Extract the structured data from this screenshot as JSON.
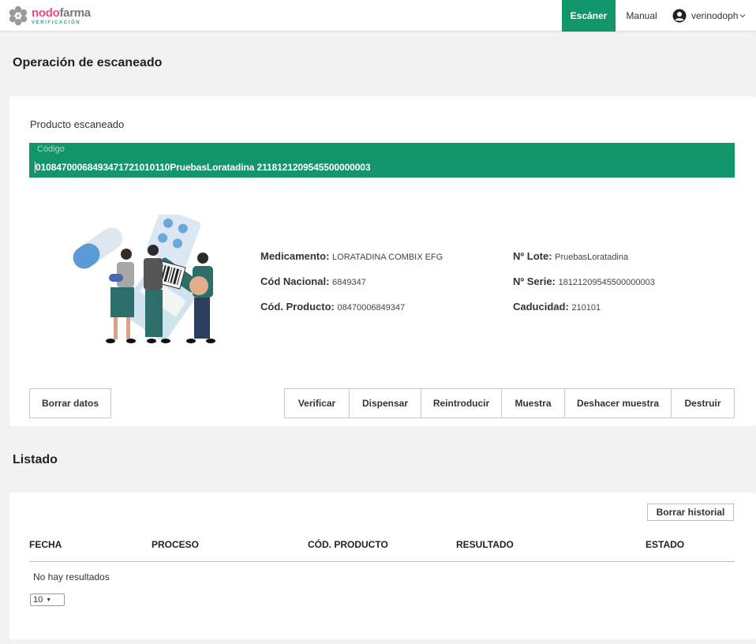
{
  "logo": {
    "name_part1": "nodo",
    "name_part2": "farma",
    "sub": "VERIFICACIÓN"
  },
  "nav": {
    "scanner": "Escáner",
    "manual": "Manual",
    "user": "verinodoph"
  },
  "scan": {
    "title": "Operación de escaneado",
    "subheading": "Producto escaneado",
    "code_label": "Código",
    "code_value": "01084700068493471721010110PruebasLoratadina 2118121209545500000003",
    "fields": {
      "medicamento_label": "Medicamento:",
      "medicamento_value": "LORATADINA COMBIX EFG",
      "nacional_label": "Cód Nacional:",
      "nacional_value": "6849347",
      "producto_label": "Cód. Producto:",
      "producto_value": "08470006849347",
      "lote_label": "Nº Lote:",
      "lote_value": "PruebasLoratadina",
      "serie_label": "Nº Serie:",
      "serie_value": "18121209545500000003",
      "caducidad_label": "Caducidad:",
      "caducidad_value": "210101"
    },
    "buttons": {
      "clear": "Borrar datos",
      "verify": "Verificar",
      "dispense": "Dispensar",
      "reintroduce": "Reintroducir",
      "sample": "Muestra",
      "undo_sample": "Deshacer muestra",
      "destroy": "Destruir"
    }
  },
  "list": {
    "title": "Listado",
    "clear_history": "Borrar historial",
    "columns": [
      "FECHA",
      "PROCESO",
      "CÓD. PRODUCTO",
      "RESULTADO",
      "ESTADO"
    ],
    "empty": "No hay resultados",
    "page_size": "10"
  },
  "colors": {
    "primary": "#13956c",
    "brand_pink": "#e84c8b"
  }
}
